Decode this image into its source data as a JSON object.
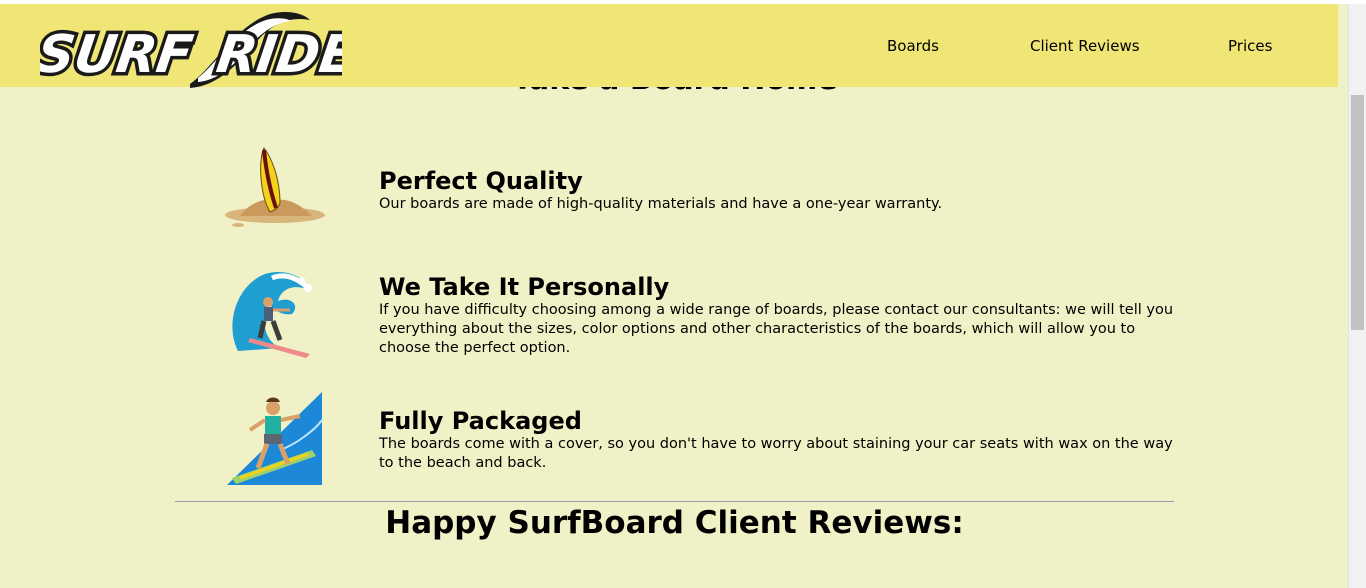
{
  "brand": {
    "logo_text": "SURF RIDE"
  },
  "nav": {
    "items": [
      {
        "label": "Boards"
      },
      {
        "label": "Client Reviews"
      },
      {
        "label": "Prices"
      }
    ]
  },
  "section": {
    "partial_heading": "Take a Board Home"
  },
  "features": [
    {
      "icon": "surfboard-on-sand-icon",
      "title": "Perfect Quality",
      "description": "Our boards are made of high-quality materials and have a one-year warranty."
    },
    {
      "icon": "surfer-wave-icon",
      "title": "We Take It Personally",
      "description": "If you have difficulty choosing among a wide range of boards, please contact our consultants: we will tell you everything about the sizes, color options and other characteristics of the boards, which will allow you to choose the perfect option."
    },
    {
      "icon": "surfer-person-icon",
      "title": "Fully Packaged",
      "description": "The boards come with a cover, so you don't have to worry about staining your car seats with wax on the way to the beach and back."
    }
  ],
  "reviews": {
    "heading": "Happy SurfBoard Client Reviews:"
  },
  "colors": {
    "navbar": "#efe675",
    "background": "#f1f1c8",
    "divider": "#9a9ab0"
  }
}
